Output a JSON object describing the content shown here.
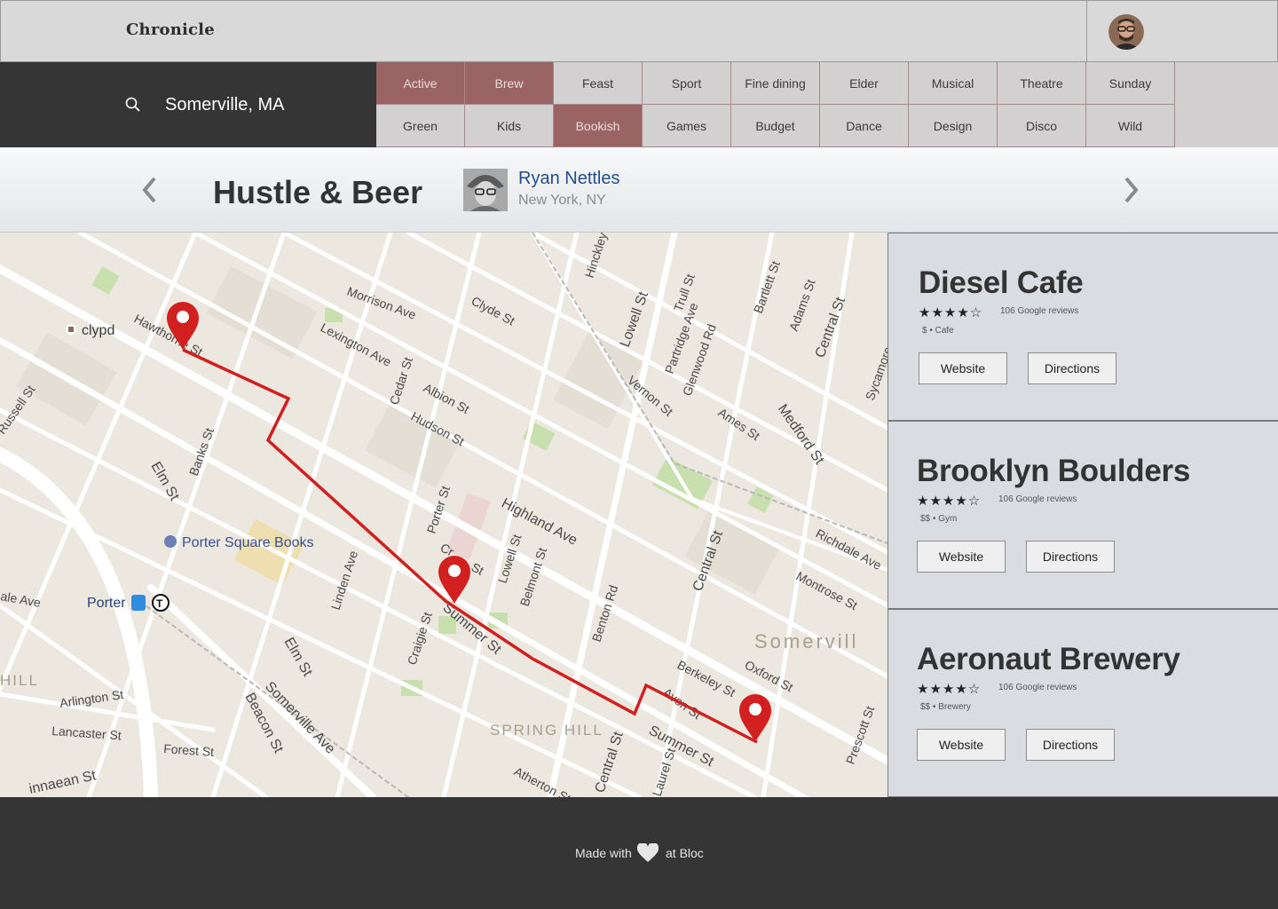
{
  "header": {
    "brand": "Chronicle"
  },
  "search": {
    "location": "Somerville, MA"
  },
  "tags": [
    {
      "label": "Active",
      "active": true
    },
    {
      "label": "Brew",
      "active": true
    },
    {
      "label": "Feast",
      "active": false
    },
    {
      "label": "Sport",
      "active": false
    },
    {
      "label": "Fine dining",
      "active": false
    },
    {
      "label": "Elder",
      "active": false
    },
    {
      "label": "Musical",
      "active": false
    },
    {
      "label": "Theatre",
      "active": false
    },
    {
      "label": "Sunday",
      "active": false
    },
    {
      "label": "Green",
      "active": false
    },
    {
      "label": "Kids",
      "active": false
    },
    {
      "label": "Bookish",
      "active": true
    },
    {
      "label": "Games",
      "active": false
    },
    {
      "label": "Budget",
      "active": false
    },
    {
      "label": "Dance",
      "active": false
    },
    {
      "label": "Design",
      "active": false
    },
    {
      "label": "Disco",
      "active": false
    },
    {
      "label": "Wild",
      "active": false
    }
  ],
  "profile": {
    "title": "Hustle & Beer",
    "author_name": "Ryan Nettles",
    "author_location": "New York, NY"
  },
  "map": {
    "labels": {
      "morrison": "Morrison Ave",
      "clyde": "Clyde St",
      "hinckley": "Hinckley",
      "lowell_n": "Lowell St",
      "trull": "Trull St",
      "partridge": "Partridge Ave",
      "glenwood": "Glenwood Rd",
      "bartlett": "Bartlett St",
      "adams": "Adams St",
      "central_ne": "Central St",
      "sycamore": "Sycamore",
      "clypd": "clypd",
      "hawthorne": "Hawthorne St",
      "lexington": "Lexington Ave",
      "cedar": "Cedar St",
      "albion": "Albion St",
      "hudson": "Hudson St",
      "vernon": "Vernon St",
      "ames": "Ames St",
      "medford": "Medford St",
      "russell": "Russell St",
      "banks": "Banks St",
      "elm_n": "Elm St",
      "porter_st": "Porter St",
      "highland": "Highland Ave",
      "richdale": "Richdale Ave",
      "porter_books": "Porter Square Books",
      "linden": "Linden Ave",
      "lowell_s": "Lowell St",
      "belmont": "Belmont St",
      "craigie_top": "Cr",
      "craigie_st": "St",
      "central_mid": "Central St",
      "montrose": "Montrose St",
      "ale_ave": "ale Ave",
      "porter": "Porter",
      "benton": "Benton Rd",
      "craigie": "Craigie St",
      "summer_mid": "Summer St",
      "somerville": "Somervill",
      "hill": "HILL",
      "elm_s": "Elm St",
      "berkeley": "Berkeley St",
      "oxford": "Oxford St",
      "arlington": "Arlington St",
      "somerville_ave": "Somerville Ave",
      "spring_hill": "SPRING HILL",
      "avon": "Avon St",
      "lancaster": "Lancaster St",
      "beacon": "Beacon St",
      "forest": "Forest St",
      "summer_s": "Summer St",
      "prescott": "Prescott St",
      "linnaean": "innaean St",
      "atherton": "Atherton St",
      "central_s": "Central St",
      "laurel": "Laurel St"
    }
  },
  "venues": [
    {
      "name": "Diesel Cafe",
      "stars": "★★★★☆",
      "reviews": "106 Google reviews",
      "price": "$",
      "category": "Cafe",
      "website": "Website",
      "directions": "Directions"
    },
    {
      "name": "Brooklyn Boulders",
      "stars": "★★★★☆",
      "reviews": "106 Google reviews",
      "price": "$$",
      "category": "Gym",
      "website": "Website",
      "directions": "Directions"
    },
    {
      "name": "Aeronaut Brewery",
      "stars": "★★★★☆",
      "reviews": "106 Google reviews",
      "price": "$$",
      "category": "Brewery",
      "website": "Website",
      "directions": "Directions"
    }
  ],
  "footer": {
    "made_with": "Made with",
    "at": "at Bloc"
  },
  "colors": {
    "tag_active": "#9a6464",
    "route": "#d21f1f",
    "link": "#1f4e8f"
  }
}
